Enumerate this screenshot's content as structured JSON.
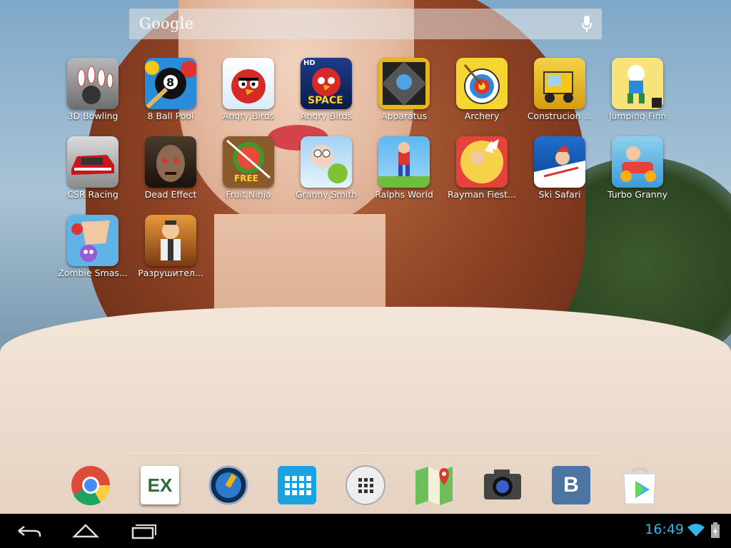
{
  "search": {
    "logo": "Google",
    "mic_icon": "microphone-icon"
  },
  "apps": [
    {
      "label": "3D Bowling"
    },
    {
      "label": "8 Ball Pool"
    },
    {
      "label": "Angry Birds"
    },
    {
      "label": "Angry Birds"
    },
    {
      "label": "Apparatus"
    },
    {
      "label": "Archery"
    },
    {
      "label": "Construcion ..."
    },
    {
      "label": "Jumping Finn"
    },
    {
      "label": "CSR Racing"
    },
    {
      "label": "Dead Effect"
    },
    {
      "label": "Fruit Ninja"
    },
    {
      "label": "Granny Smith"
    },
    {
      "label": "Ralphs World"
    },
    {
      "label": "Rayman Fiest..."
    },
    {
      "label": "Ski Safari"
    },
    {
      "label": "Turbo Granny"
    },
    {
      "label": "Zombie Smas..."
    },
    {
      "label": "Разрушител..."
    }
  ],
  "app_icon_text": {
    "angry_birds_space": "SPACE",
    "angry_birds_space_hd": "HD",
    "fruit_ninja_free": "FREE",
    "pool_ball": "8"
  },
  "dock": {
    "items": [
      "chrome-icon",
      "ex-file-explorer-icon",
      "cleaner-icon",
      "keyboard-icon",
      "all-apps-icon",
      "maps-icon",
      "camera-icon",
      "vk-icon",
      "play-store-icon"
    ],
    "ex_text": "EX",
    "vk_text": "B"
  },
  "status": {
    "time": "16:49",
    "wifi": "wifi-icon",
    "battery": "battery-charging-icon"
  },
  "nav": [
    "back-icon",
    "home-icon",
    "recent-apps-icon"
  ]
}
